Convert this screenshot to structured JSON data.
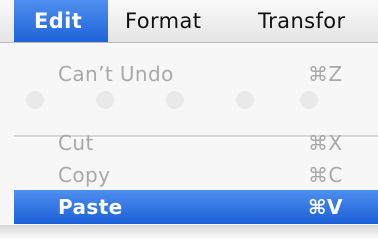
{
  "menubar": {
    "items": [
      {
        "label": "Edit"
      },
      {
        "label": "Format"
      },
      {
        "label": "Transfor"
      }
    ]
  },
  "edit_menu": {
    "undo": {
      "label": "Can’t Undo",
      "shortcut": "⌘Z",
      "enabled": false
    },
    "cut": {
      "label": "Cut",
      "shortcut": "⌘X",
      "enabled": false
    },
    "copy": {
      "label": "Copy",
      "shortcut": "⌘C",
      "enabled": false
    },
    "paste": {
      "label": "Paste",
      "shortcut": "⌘V",
      "enabled": true,
      "highlighted": true
    }
  },
  "colors": {
    "highlight": "#1f63d8",
    "disabled_text": "#a9a9a9"
  }
}
